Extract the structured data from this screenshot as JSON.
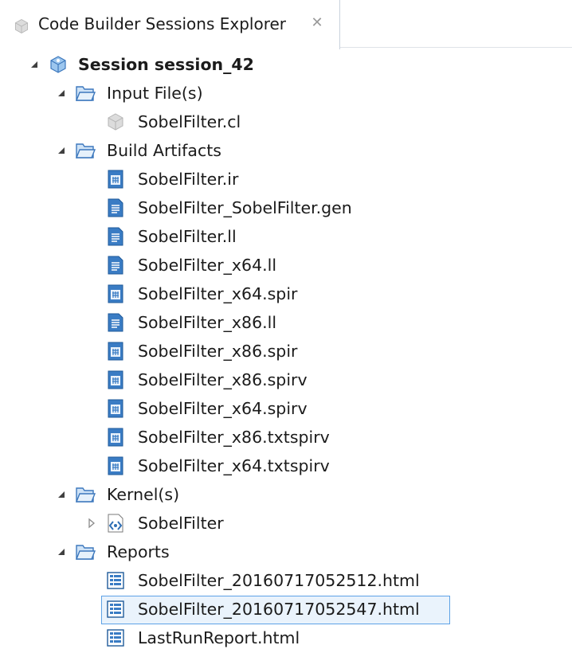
{
  "tab": {
    "title": "Code Builder Sessions Explorer",
    "close_glyph": "✕"
  },
  "tree": {
    "session": {
      "label": "Session session_42",
      "icon": "session-cube-icon",
      "expanded": true
    },
    "input_files": {
      "label": "Input File(s)",
      "icon": "folder-open-icon",
      "expanded": true,
      "items": [
        {
          "label": "SobelFilter.cl",
          "icon": "source-cube-icon"
        }
      ]
    },
    "build_artifacts": {
      "label": "Build Artifacts",
      "icon": "folder-open-icon",
      "expanded": true,
      "items": [
        {
          "label": "SobelFilter.ir",
          "icon": "binary-file-icon"
        },
        {
          "label": "SobelFilter_SobelFilter.gen",
          "icon": "text-file-icon"
        },
        {
          "label": "SobelFilter.ll",
          "icon": "text-file-icon"
        },
        {
          "label": "SobelFilter_x64.ll",
          "icon": "text-file-icon"
        },
        {
          "label": "SobelFilter_x64.spir",
          "icon": "binary-file-icon"
        },
        {
          "label": "SobelFilter_x86.ll",
          "icon": "text-file-icon"
        },
        {
          "label": "SobelFilter_x86.spir",
          "icon": "binary-file-icon"
        },
        {
          "label": "SobelFilter_x86.spirv",
          "icon": "binary-file-icon"
        },
        {
          "label": "SobelFilter_x64.spirv",
          "icon": "binary-file-icon"
        },
        {
          "label": "SobelFilter_x86.txtspirv",
          "icon": "binary-file-icon"
        },
        {
          "label": "SobelFilter_x64.txtspirv",
          "icon": "binary-file-icon"
        }
      ]
    },
    "kernels": {
      "label": "Kernel(s)",
      "icon": "folder-open-icon",
      "expanded": true,
      "items": [
        {
          "label": "SobelFilter",
          "icon": "kernel-code-icon",
          "expanded": false
        }
      ]
    },
    "reports": {
      "label": "Reports",
      "icon": "folder-open-icon",
      "expanded": true,
      "items": [
        {
          "label": "SobelFilter_20160717052512.html",
          "icon": "report-html-icon",
          "selected": false
        },
        {
          "label": "SobelFilter_20160717052547.html",
          "icon": "report-html-icon",
          "selected": true
        },
        {
          "label": "LastRunReport.html",
          "icon": "report-html-icon",
          "selected": false
        }
      ]
    }
  },
  "colors": {
    "selection_border": "#5ea2e6",
    "selection_fill": "#eaf3fc",
    "folder": "#4a86c7",
    "file_blue": "#2f6fb5"
  }
}
